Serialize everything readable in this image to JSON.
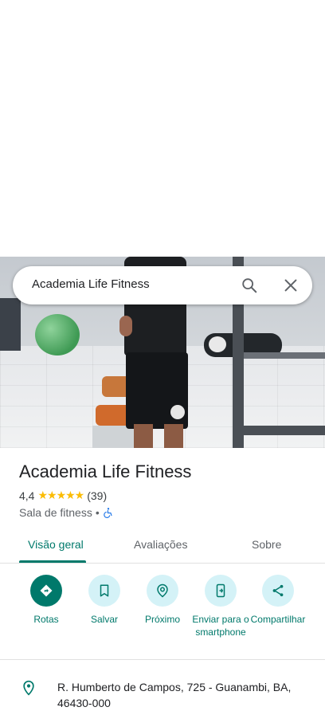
{
  "search": {
    "query": "Academia Life Fitness"
  },
  "place": {
    "name": "Academia Life Fitness",
    "rating": "4,4",
    "stars": "★★★★★",
    "review_count": "(39)",
    "category": "Sala de fitness",
    "separator": "•"
  },
  "tabs": [
    {
      "label": "Visão geral",
      "active": true
    },
    {
      "label": "Avaliações"
    },
    {
      "label": "Sobre"
    }
  ],
  "actions": [
    {
      "label": "Rotas",
      "icon": "directions-icon"
    },
    {
      "label": "Salvar",
      "icon": "bookmark-icon"
    },
    {
      "label": "Próximo",
      "icon": "nearby-icon"
    },
    {
      "label": "Enviar para o smartphone",
      "icon": "send-to-phone-icon"
    },
    {
      "label": "Compartilhar",
      "icon": "share-icon"
    }
  ],
  "address": {
    "text": "R. Humberto de Campos, 725 - Guanambi, BA, 46430-000"
  },
  "colors": {
    "accent": "#00796b",
    "action_bg": "#d4f2f7",
    "star": "#fbbc04"
  }
}
